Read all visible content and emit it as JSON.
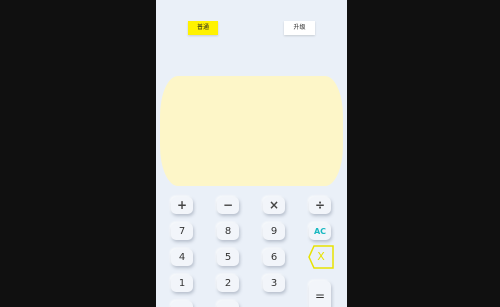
{
  "tabs": {
    "normal": "普通",
    "upgrade": "升级"
  },
  "keys": {
    "plus": "+",
    "minus": "−",
    "multiply": "×",
    "divide": "÷",
    "seven": "7",
    "eight": "8",
    "nine": "9",
    "ac": "AC",
    "four": "4",
    "five": "5",
    "six": "6",
    "backspace": "X",
    "one": "1",
    "two": "2",
    "three": "3",
    "equals": "="
  },
  "colors": {
    "active_tab": "#fff200",
    "display_bg": "#fdf6c8",
    "ac_text": "#18b8c0",
    "backspace": "#e8e200"
  }
}
